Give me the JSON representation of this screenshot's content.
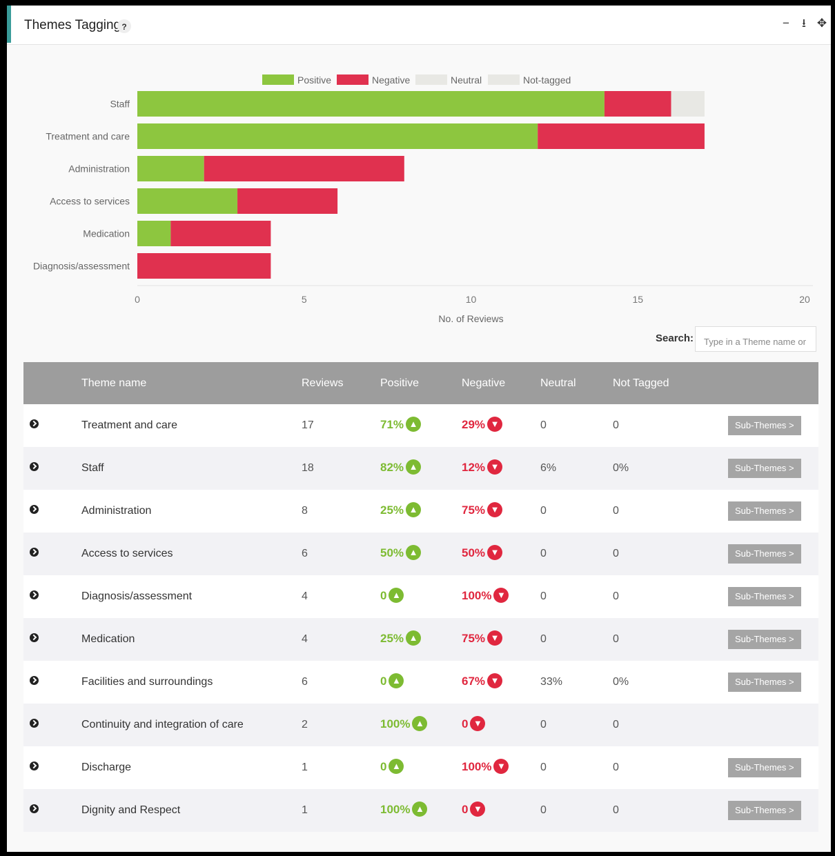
{
  "widget": {
    "title": "Themes Tagging",
    "help_icon": "?"
  },
  "header_tools": [
    {
      "name": "minimize-icon",
      "glyph": "−"
    },
    {
      "name": "download-icon",
      "glyph": "⭳"
    },
    {
      "name": "move-icon",
      "glyph": "✥"
    }
  ],
  "chart_data": {
    "type": "bar",
    "orientation": "horizontal",
    "stacked": true,
    "categories": [
      "Staff",
      "Treatment and care",
      "Administration",
      "Access to services",
      "Medication",
      "Diagnosis/assessment"
    ],
    "series": [
      {
        "name": "Positive",
        "color": "#8dc63f",
        "values": [
          14,
          12,
          2,
          3,
          1,
          0
        ]
      },
      {
        "name": "Negative",
        "color": "#e0314f",
        "values": [
          2,
          5,
          6,
          3,
          3,
          4
        ]
      },
      {
        "name": "Neutral",
        "color": "#e8e8e4",
        "values": [
          1,
          0,
          0,
          0,
          0,
          0
        ]
      },
      {
        "name": "Not-tagged",
        "color": "#e8e8e4",
        "values": [
          0,
          0,
          0,
          0,
          0,
          0
        ]
      }
    ],
    "xlabel": "No. of Reviews",
    "xlim": [
      0,
      20
    ],
    "xticks": [
      "0",
      "5",
      "10",
      "15",
      "20"
    ],
    "legend_position": "top-center",
    "grid": false
  },
  "search": {
    "label": "Search:",
    "placeholder": "Type in a Theme name or"
  },
  "table": {
    "headers": [
      "",
      "Theme name",
      "Reviews",
      "Positive",
      "Negative",
      "Neutral",
      "Not Tagged",
      ""
    ],
    "button_label": "Sub-Themes >",
    "rows": [
      {
        "name": "Treatment and care",
        "reviews": "17",
        "positive": "71%",
        "negative": "29%",
        "neutral": "0",
        "not_tagged": "0",
        "has_sub": true
      },
      {
        "name": "Staff",
        "reviews": "18",
        "positive": "82%",
        "negative": "12%",
        "neutral": "6%",
        "not_tagged": "0%",
        "has_sub": true
      },
      {
        "name": "Administration",
        "reviews": "8",
        "positive": "25%",
        "negative": "75%",
        "neutral": "0",
        "not_tagged": "0",
        "has_sub": true
      },
      {
        "name": "Access to services",
        "reviews": "6",
        "positive": "50%",
        "negative": "50%",
        "neutral": "0",
        "not_tagged": "0",
        "has_sub": true
      },
      {
        "name": "Diagnosis/assessment",
        "reviews": "4",
        "positive": "0",
        "negative": "100%",
        "neutral": "0",
        "not_tagged": "0",
        "has_sub": true
      },
      {
        "name": "Medication",
        "reviews": "4",
        "positive": "25%",
        "negative": "75%",
        "neutral": "0",
        "not_tagged": "0",
        "has_sub": true
      },
      {
        "name": "Facilities and surroundings",
        "reviews": "6",
        "positive": "0",
        "negative": "67%",
        "neutral": "33%",
        "not_tagged": "0%",
        "has_sub": true
      },
      {
        "name": "Continuity and integration of care",
        "reviews": "2",
        "positive": "100%",
        "negative": "0",
        "neutral": "0",
        "not_tagged": "0",
        "has_sub": false
      },
      {
        "name": "Discharge",
        "reviews": "1",
        "positive": "0",
        "negative": "100%",
        "neutral": "0",
        "not_tagged": "0",
        "has_sub": true
      },
      {
        "name": "Dignity and Respect",
        "reviews": "1",
        "positive": "100%",
        "negative": "0",
        "neutral": "0",
        "not_tagged": "0",
        "has_sub": true
      }
    ]
  }
}
